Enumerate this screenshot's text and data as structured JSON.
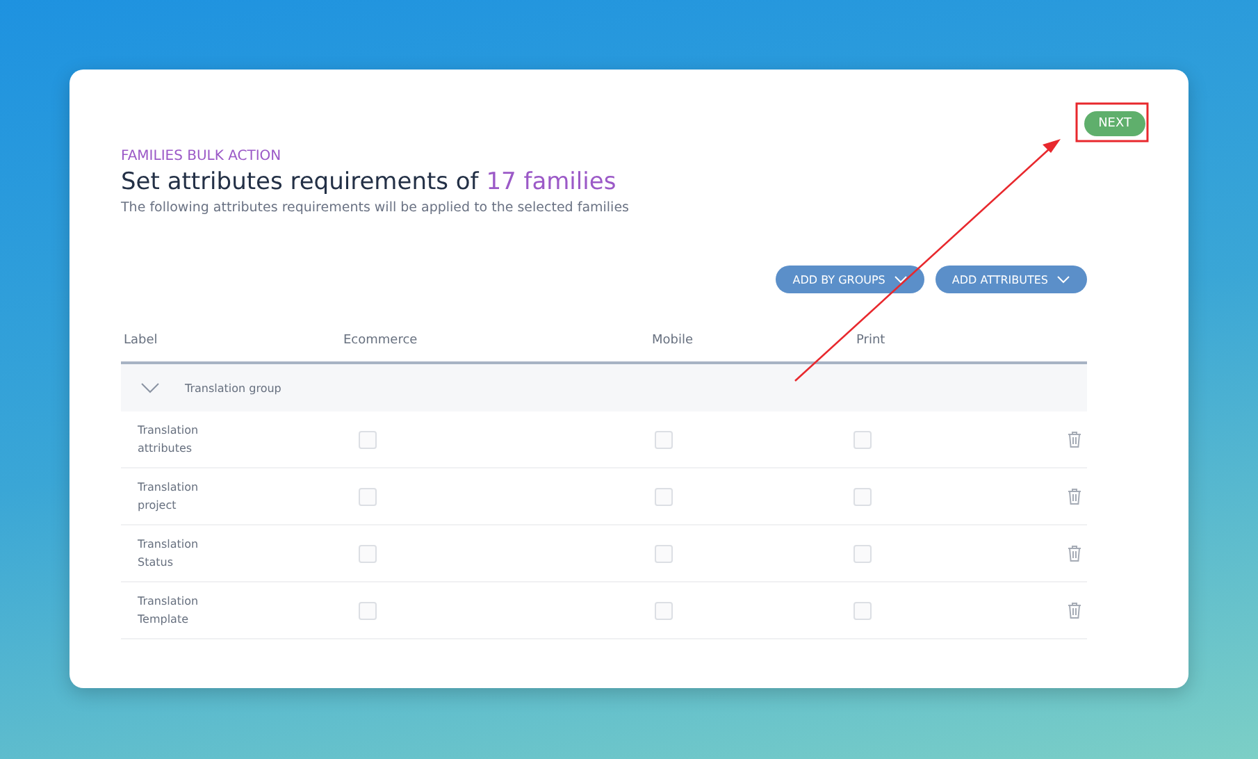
{
  "header": {
    "eyebrow": "FAMILIES BULK ACTION",
    "title_prefix": "Set attributes requirements of",
    "title_highlight": "17 families",
    "subtitle": "The following attributes requirements will be applied to the selected families"
  },
  "next_button": {
    "label": "NEXT",
    "highlighted": true
  },
  "actions": [
    {
      "label": "ADD BY GROUPS"
    },
    {
      "label": "ADD ATTRIBUTES"
    }
  ],
  "table": {
    "columns": [
      "Label",
      "Ecommerce",
      "Mobile",
      "Print"
    ],
    "group": {
      "label": "Translation group",
      "expanded": true
    },
    "rows": [
      {
        "label": "Translation attributes",
        "checks": [
          {
            "checked": false
          },
          {
            "checked": false
          },
          {
            "checked": false
          }
        ]
      },
      {
        "label": "Translation project",
        "checks": [
          {
            "checked": false
          },
          {
            "checked": false
          },
          {
            "checked": false
          }
        ]
      },
      {
        "label": "Translation Status",
        "checks": [
          {
            "checked": false
          },
          {
            "checked": false
          },
          {
            "checked": false
          }
        ]
      },
      {
        "label": "Translation Template",
        "checks": [
          {
            "checked": false
          },
          {
            "checked": false
          },
          {
            "checked": false
          }
        ]
      }
    ]
  }
}
